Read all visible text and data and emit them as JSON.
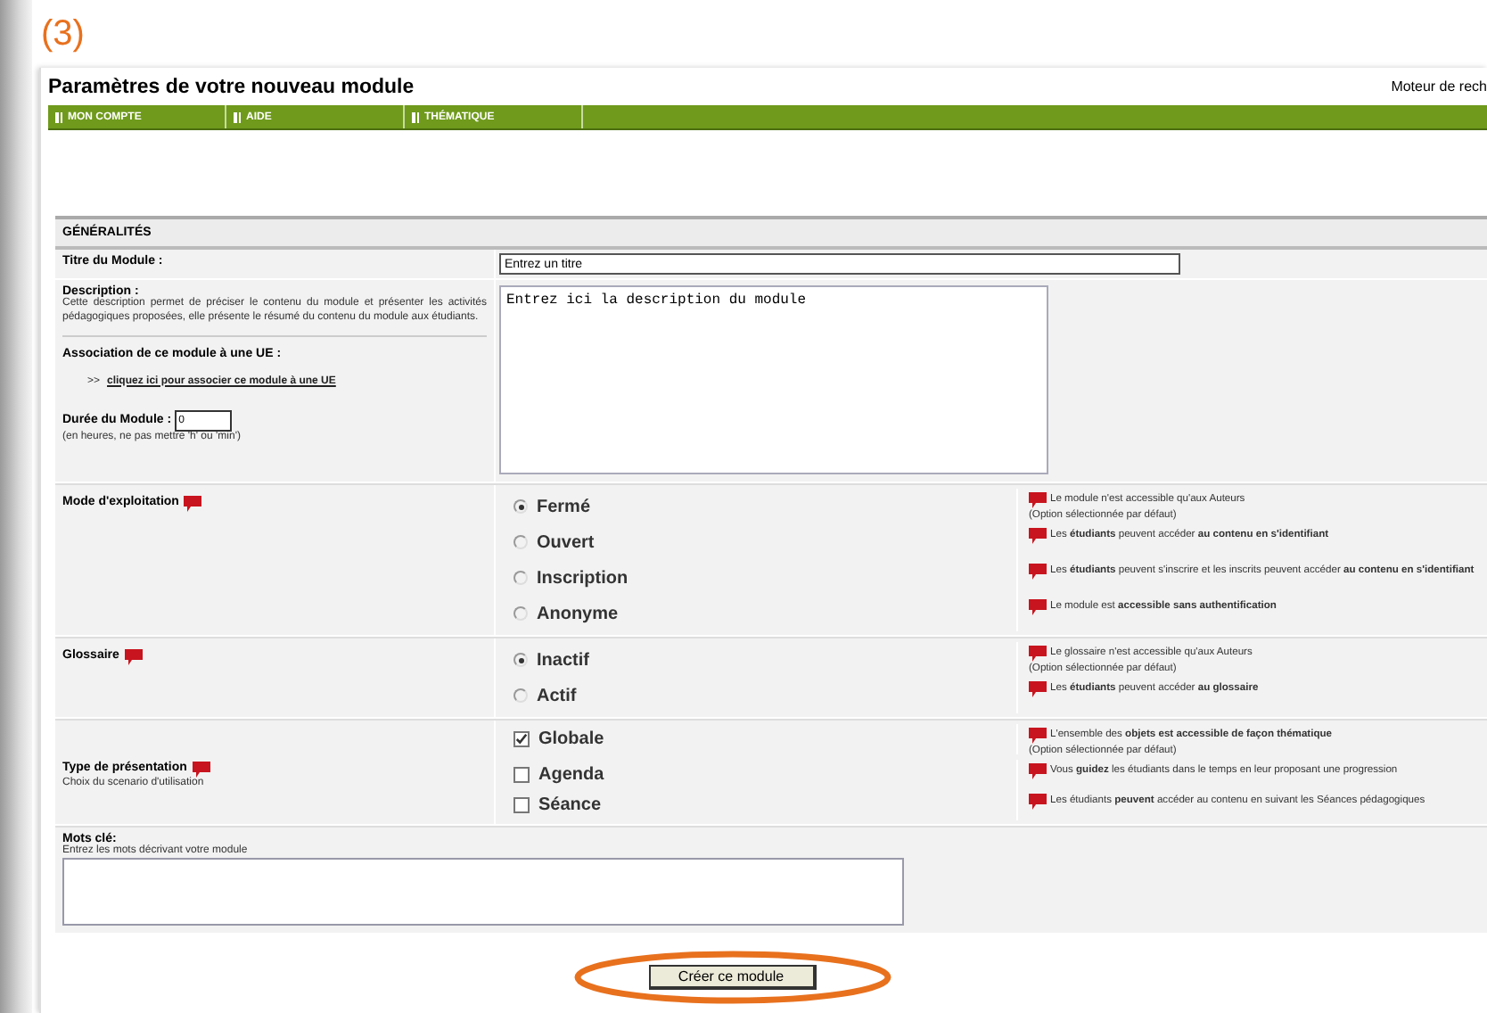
{
  "caption": "(3)",
  "title": "Paramètres de votre nouveau module",
  "search_label": "Moteur de rech",
  "nav": [
    "MON COMPTE",
    "AIDE",
    "THÉMATIQUE"
  ],
  "section_header": "GÉNÉRALITÉS",
  "title_field": {
    "label": "Titre du Module :",
    "value": "Entrez un titre"
  },
  "description": {
    "label": "Description :",
    "help": "Cette description permet de préciser le contenu du module et présenter les activités pédagogiques proposées, elle présente le résumé du contenu du module aux étudiants.",
    "value": "Entrez ici la description du module"
  },
  "association": {
    "label": "Association de ce module à une UE :",
    "prefix": ">>",
    "link": "cliquez ici pour associer ce module à une UE"
  },
  "duration": {
    "label": "Durée du Module :",
    "value": "0",
    "help": "(en heures, ne pas mettre 'h' ou 'min')"
  },
  "option_groups": [
    {
      "kind": "radio",
      "label": "Mode d'exploitation",
      "options": [
        {
          "label": "Fermé",
          "selected": true,
          "hint": "Le module n'est accessible qu'aux Auteurs",
          "note": "(Option sélectionnée par défaut)"
        },
        {
          "label": "Ouvert",
          "selected": false,
          "hint": "Les **étudiants** peuvent accéder **au contenu en s'identifiant**"
        },
        {
          "label": "Inscription",
          "selected": false,
          "hint": "Les **étudiants** peuvent s'inscrire et les inscrits peuvent accéder **au contenu en s'identifiant**"
        },
        {
          "label": "Anonyme",
          "selected": false,
          "hint": "Le module est **accessible sans authentification**"
        }
      ]
    },
    {
      "kind": "radio",
      "label": "Glossaire",
      "options": [
        {
          "label": "Inactif",
          "selected": true,
          "hint": "Le glossaire n'est accessible qu'aux Auteurs",
          "note": "(Option sélectionnée par défaut)"
        },
        {
          "label": "Actif",
          "selected": false,
          "hint": "Les **étudiants** peuvent accéder **au glossaire**"
        }
      ]
    },
    {
      "kind": "checkbox",
      "label": "Type de présentation",
      "sublabel": "Choix du scenario d'utilisation",
      "options": [
        {
          "label": "Globale",
          "checked": true,
          "hint": "L'ensemble des **objets est accessible de façon thématique**",
          "note": "(Option sélectionnée par défaut)"
        },
        {
          "label": "Agenda",
          "checked": false,
          "hint": "Vous **guidez** les étudiants dans le temps en leur proposant une progression"
        },
        {
          "label": "Séance",
          "checked": false,
          "hint": "Les étudiants **peuvent** accéder au contenu en suivant les Séances pédagogiques"
        }
      ]
    }
  ],
  "keywords": {
    "label": "Mots clé:",
    "help": "Entrez les mots décrivant votre module"
  },
  "submit": "Créer ce module"
}
